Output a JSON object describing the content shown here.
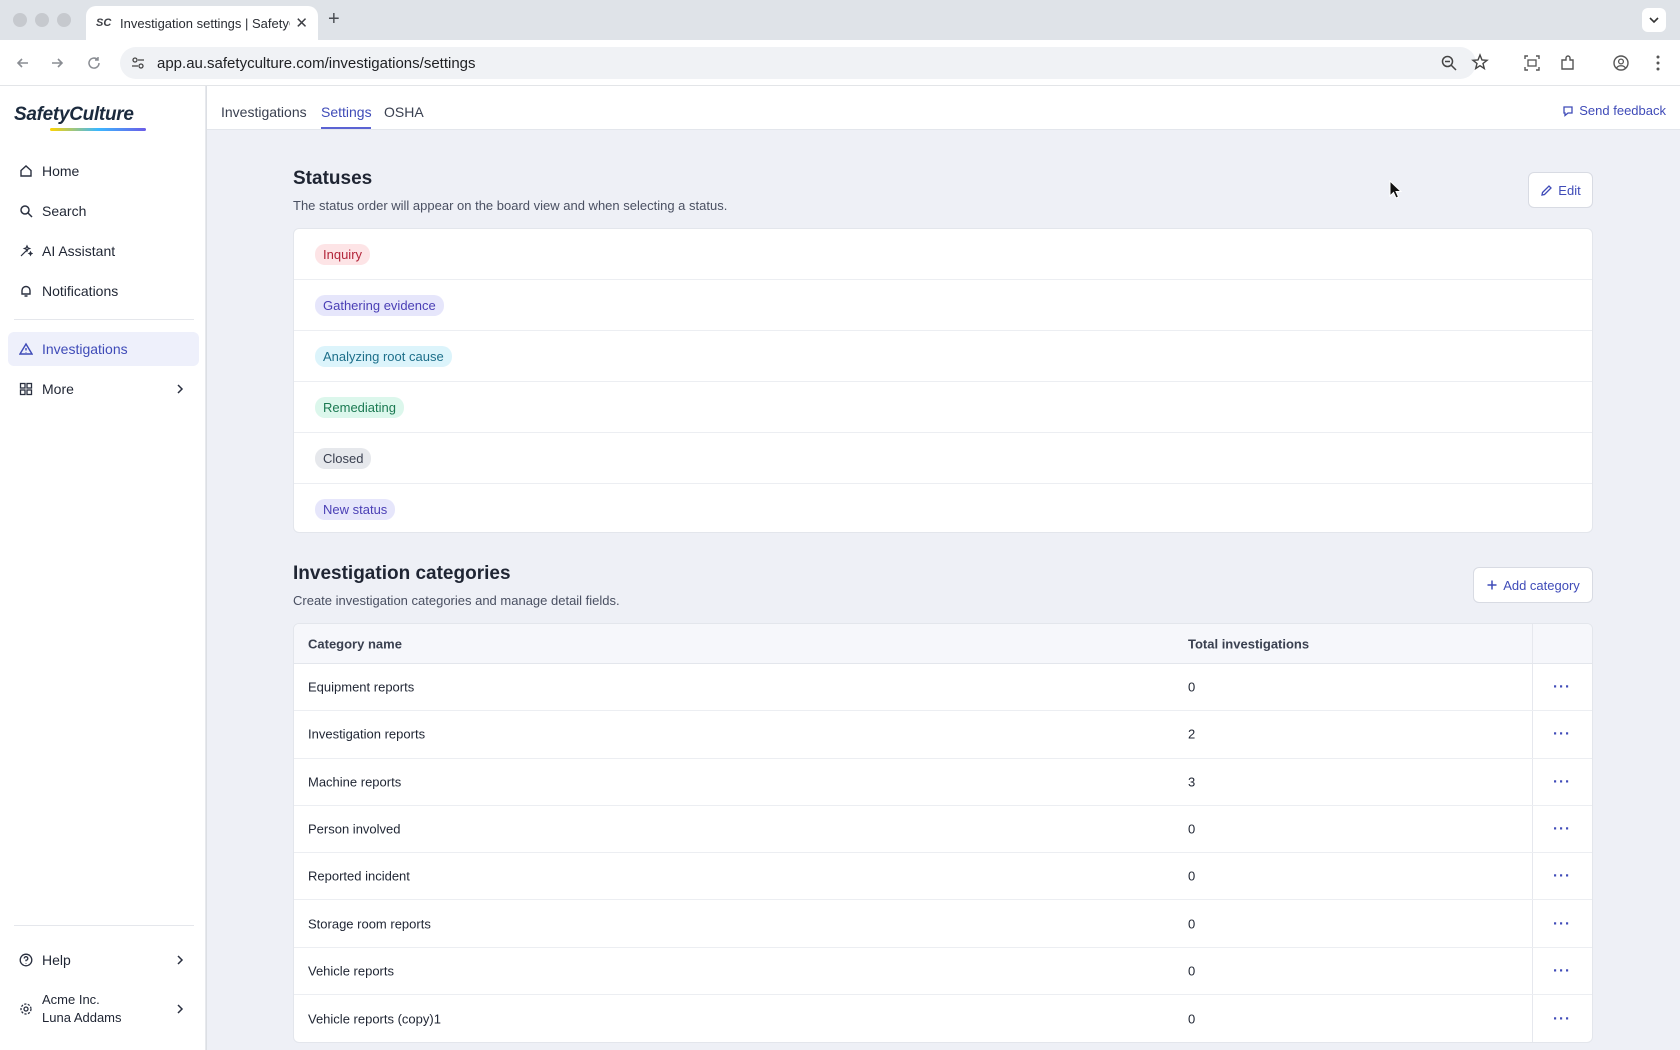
{
  "browser": {
    "tab_title": "Investigation settings | SafetyCulture",
    "tab_favicon": "SC",
    "url": "app.au.safetyculture.com/investigations/settings"
  },
  "sidebar": {
    "logo": "SafetyCulture",
    "items": [
      {
        "label": "Home",
        "icon": "home-icon"
      },
      {
        "label": "Search",
        "icon": "search-icon"
      },
      {
        "label": "AI Assistant",
        "icon": "sparkle-icon"
      },
      {
        "label": "Notifications",
        "icon": "bell-icon"
      },
      {
        "label": "Investigations",
        "icon": "warning-triangle-icon",
        "active": true
      },
      {
        "label": "More",
        "icon": "grid-icon"
      }
    ],
    "help": "Help",
    "org": "Acme Inc.",
    "user": "Luna Addams"
  },
  "topnav": {
    "tabs": [
      "Investigations",
      "Settings",
      "OSHA"
    ],
    "active_tab": "Settings",
    "feedback": "Send feedback"
  },
  "statuses": {
    "title": "Statuses",
    "description": "The status order will appear on the board view and when selecting a status.",
    "edit_label": "Edit",
    "items": [
      {
        "label": "Inquiry",
        "bg": "#fde4e6",
        "fg": "#b3263a"
      },
      {
        "label": "Gathering evidence",
        "bg": "#e6e6fb",
        "fg": "#4a3fb5"
      },
      {
        "label": "Analyzing root cause",
        "bg": "#dcf4fb",
        "fg": "#1d6f8a"
      },
      {
        "label": "Remediating",
        "bg": "#dcf7ec",
        "fg": "#1b7a52"
      },
      {
        "label": "Closed",
        "bg": "#e6e8ec",
        "fg": "#3a4050"
      },
      {
        "label": "New status",
        "bg": "#e6e6fb",
        "fg": "#4a3fb5"
      }
    ]
  },
  "categories": {
    "title": "Investigation categories",
    "description": "Create investigation categories and manage detail fields.",
    "add_label": "Add category",
    "columns": [
      "Category name",
      "Total investigations"
    ],
    "rows": [
      {
        "name": "Equipment reports",
        "total": "0"
      },
      {
        "name": "Investigation reports",
        "total": "2"
      },
      {
        "name": "Machine reports",
        "total": "3"
      },
      {
        "name": "Person involved",
        "total": "0"
      },
      {
        "name": "Reported incident",
        "total": "0"
      },
      {
        "name": "Storage room reports",
        "total": "0"
      },
      {
        "name": "Vehicle reports",
        "total": "0"
      },
      {
        "name": "Vehicle reports (copy)1",
        "total": "0"
      }
    ],
    "row_action": "···"
  }
}
